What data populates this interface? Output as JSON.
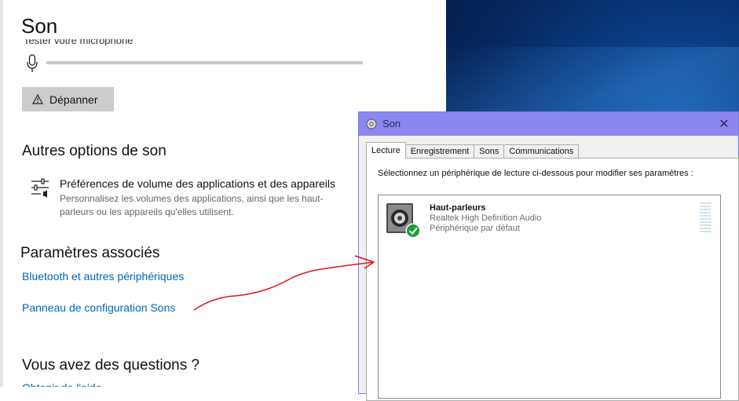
{
  "settings": {
    "title": "Son",
    "mic_test_cut": "Tester votre microphone",
    "troubleshoot_label": "Dépanner",
    "more_options_heading": "Autres options de son",
    "app_volume": {
      "title": "Préférences de volume des applications et des appareils",
      "description": "Personnalisez les volumes des applications, ainsi que les haut-parleurs ou les appareils qu'elles utilisent."
    },
    "related_heading": "Paramètres associés",
    "links": [
      "Bluetooth et autres périphériques",
      "Panneau de configuration Sons"
    ],
    "questions_heading": "Vous avez des questions ?",
    "help_link_cut": "Obtenir de l'aide"
  },
  "dialog": {
    "title": "Son",
    "close_glyph": "✕",
    "tabs": [
      {
        "label": "Lecture",
        "active": true
      },
      {
        "label": "Enregistrement",
        "active": false
      },
      {
        "label": "Sons",
        "active": false
      },
      {
        "label": "Communications",
        "active": false
      }
    ],
    "instruction": "Sélectionnez un périphérique de lecture ci-dessous pour modifier ses paramètres :",
    "device": {
      "name": "Haut-parleurs",
      "driver": "Realtek High Definition Audio",
      "status": "Périphérique par défaut",
      "icon": "speaker-icon",
      "badge_icon": "default-check-icon"
    }
  },
  "colors": {
    "link": "#0067b8",
    "dialog_titlebar": "#8c87f0",
    "annotation_arrow": "#e0131b",
    "default_badge": "#1a9f32"
  }
}
